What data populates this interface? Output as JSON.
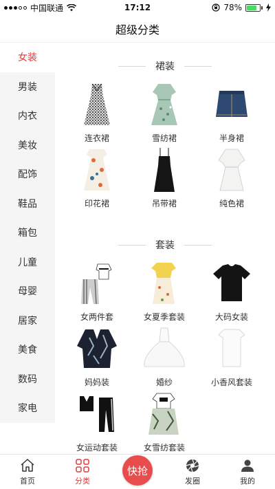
{
  "status_bar": {
    "carrier": "中国联通",
    "time": "17:12",
    "battery": "78%"
  },
  "nav": {
    "title": "超级分类"
  },
  "sidebar": {
    "items": [
      {
        "label": "女装"
      },
      {
        "label": "男装"
      },
      {
        "label": "内衣"
      },
      {
        "label": "美妆"
      },
      {
        "label": "配饰"
      },
      {
        "label": "鞋品"
      },
      {
        "label": "箱包"
      },
      {
        "label": "儿童"
      },
      {
        "label": "母婴"
      },
      {
        "label": "居家"
      },
      {
        "label": "美食"
      },
      {
        "label": "数码"
      },
      {
        "label": "家电"
      }
    ]
  },
  "sections": [
    {
      "title": "裙装",
      "items": [
        {
          "label": "连衣裙",
          "icon": "gingham-dress-icon"
        },
        {
          "label": "雪纺裙",
          "icon": "floral-chiffon-dress-icon"
        },
        {
          "label": "半身裙",
          "icon": "denim-skirt-icon"
        },
        {
          "label": "印花裙",
          "icon": "print-dress-icon"
        },
        {
          "label": "吊带裙",
          "icon": "slip-dress-icon"
        },
        {
          "label": "纯色裙",
          "icon": "white-dress-icon"
        }
      ]
    },
    {
      "title": "套装",
      "items": [
        {
          "label": "女两件套",
          "icon": "two-piece-set-icon"
        },
        {
          "label": "女夏季套装",
          "icon": "summer-set-icon"
        },
        {
          "label": "大码女装",
          "icon": "plus-size-tee-icon"
        },
        {
          "label": "妈妈装",
          "icon": "mom-outfit-icon"
        },
        {
          "label": "婚纱",
          "icon": "wedding-dress-icon"
        },
        {
          "label": "小香风套装",
          "icon": "chanel-style-dress-icon"
        },
        {
          "label": "女运动套装",
          "icon": "sport-set-icon"
        },
        {
          "label": "女雪纺套装",
          "icon": "chiffon-set-icon"
        }
      ]
    }
  ],
  "tab_bar": {
    "tabs": [
      {
        "label": "首页",
        "icon": "home-icon"
      },
      {
        "label": "分类",
        "icon": "category-icon"
      },
      {
        "label": "快抢",
        "icon": "flash-sale-button"
      },
      {
        "label": "发圈",
        "icon": "aperture-icon"
      },
      {
        "label": "我的",
        "icon": "user-icon"
      }
    ]
  },
  "colors": {
    "accent": "#e23a3a",
    "sidebar_bg": "#f5f5f5",
    "battery_green": "#4cd964",
    "flash_button": "#e84d4d"
  }
}
